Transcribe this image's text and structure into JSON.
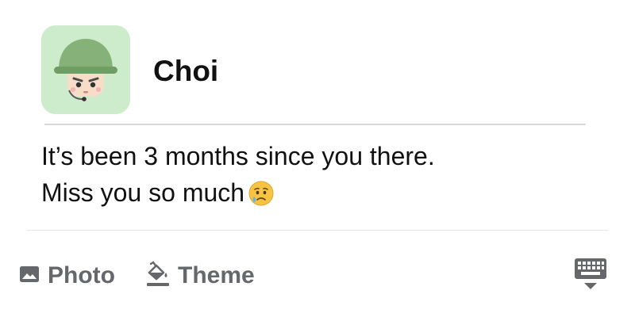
{
  "user": {
    "name": "Choi",
    "avatar_icon": "soldier-avatar-icon",
    "avatar_bg": "#cdeccc"
  },
  "post": {
    "line1": "It’s been 3 months since you there.",
    "line2": "Miss you so much",
    "emoji_icon": "crying-face-emoji"
  },
  "toolbar": {
    "photo_label": "Photo",
    "photo_icon": "photo-icon",
    "theme_label": "Theme",
    "theme_icon": "paint-bucket-icon",
    "keyboard_icon": "keyboard-hide-icon",
    "icon_color": "#65676b"
  }
}
